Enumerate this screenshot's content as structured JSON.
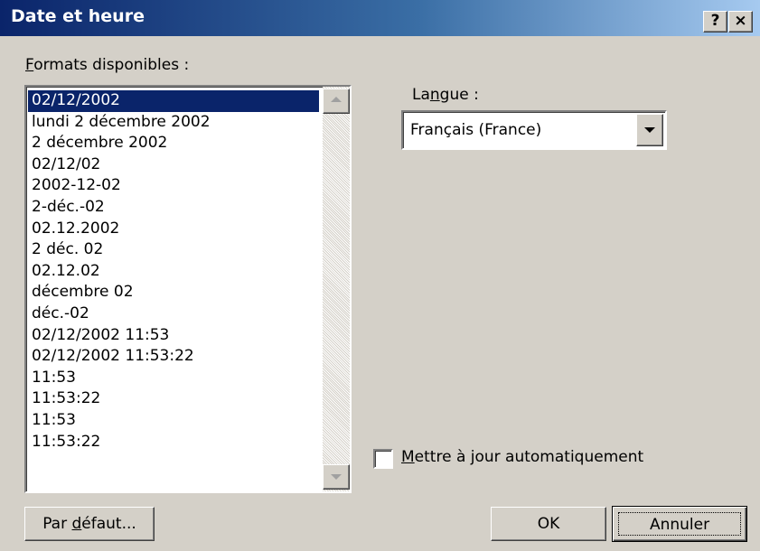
{
  "dialog": {
    "title": "Date et heure",
    "help_label": "?",
    "close_label": "×"
  },
  "formats": {
    "label_accel": "F",
    "label_rest": "ormats disponibles :",
    "items": [
      "02/12/2002",
      "lundi 2 décembre 2002",
      "2 décembre 2002",
      "02/12/02",
      "2002-12-02",
      "2-déc.-02",
      "02.12.2002",
      "2 déc. 02",
      "02.12.02",
      "décembre 02",
      "déc.-02",
      "02/12/2002 11:53",
      "02/12/2002 11:53:22",
      "11:53",
      "11:53:22",
      "11:53",
      "11:53:22"
    ],
    "selected_index": 0
  },
  "language": {
    "label_pre": "La",
    "label_accel": "n",
    "label_post": "gue :",
    "value": "Français (France)"
  },
  "auto_update": {
    "label_accel": "M",
    "label_rest": "ettre à jour automatiquement",
    "checked": false
  },
  "buttons": {
    "default_pre": "Par ",
    "default_accel": "d",
    "default_post": "éfaut...",
    "ok": "OK",
    "cancel": "Annuler"
  },
  "colors": {
    "title_start": "#0a246a",
    "title_end": "#a6caf0",
    "selection": "#0a246a",
    "face": "#d4d0c8"
  }
}
